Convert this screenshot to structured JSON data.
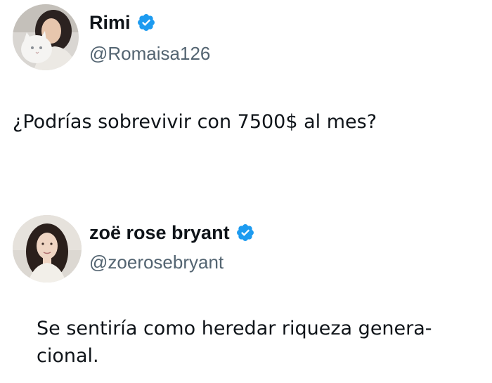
{
  "tweets": [
    {
      "author": {
        "display_name": "Rimi",
        "handle": "@Romaisa126",
        "verified": true,
        "avatar_icon": "woman-with-white-cat-avatar"
      },
      "text": "¿Podrías sobrevivir con 7500$ al mes?"
    },
    {
      "author": {
        "display_name": "zoë rose bryant",
        "handle": "@zoerosebryant",
        "verified": true,
        "avatar_icon": "woman-portrait-avatar"
      },
      "text": "Se sentiría como heredar riqueza genera-\ncional."
    }
  ],
  "colors": {
    "verified_badge": "#1d9bf0",
    "handle": "#536471",
    "text": "#0f1419",
    "background": "#ffffff"
  }
}
